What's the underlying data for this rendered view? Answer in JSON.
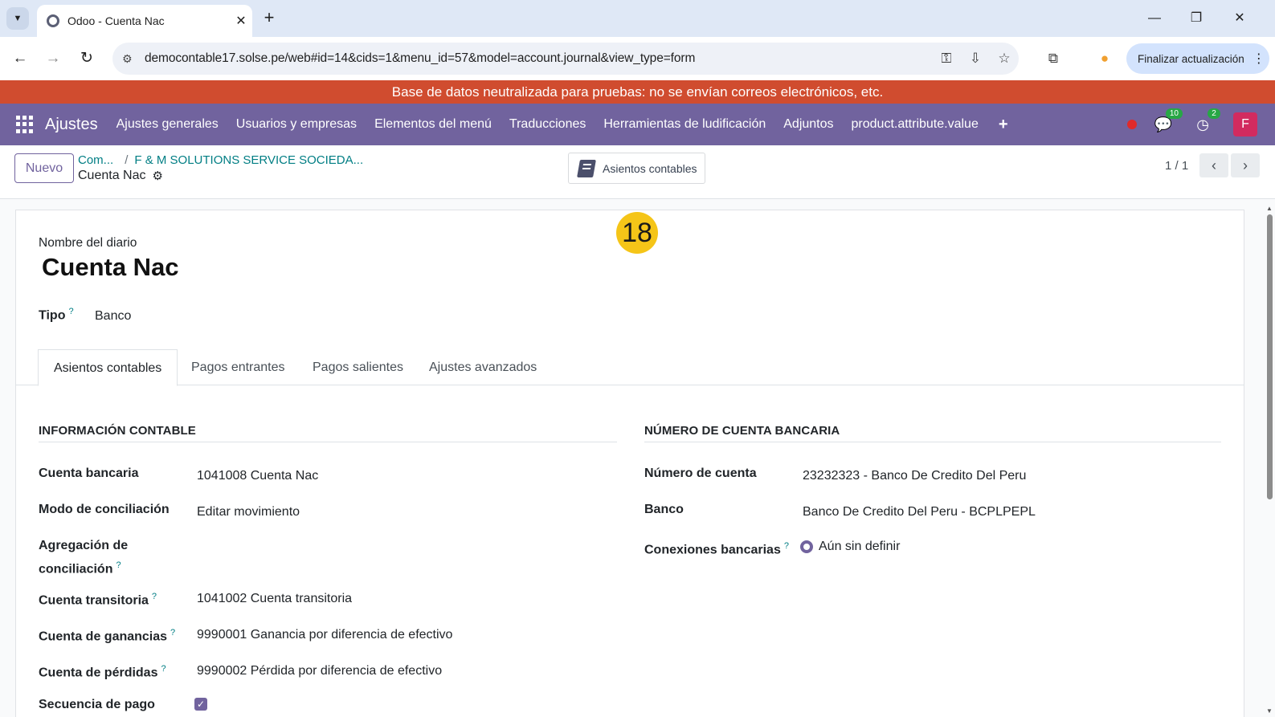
{
  "browser": {
    "tab_title": "Odoo - Cuenta Nac",
    "tab_close": "✕",
    "new_tab": "+",
    "url": "democontable17.solse.pe/web#id=14&cids=1&menu_id=57&model=account.journal&view_type=form",
    "update_button": "Finalizar actualización"
  },
  "banner": {
    "text": "Base de datos neutralizada para pruebas: no se envían correos electrónicos, etc."
  },
  "navbar": {
    "brand": "Ajustes",
    "items": [
      "Ajustes generales",
      "Usuarios y empresas",
      "Elementos del menú",
      "Traducciones",
      "Herramientas de ludificación",
      "Adjuntos",
      "product.attribute.value"
    ],
    "plus": "+",
    "messages_count": "10",
    "activities_count": "2",
    "avatar_letter": "F",
    "colors": {
      "navbar": "#71639e",
      "banner": "#d04c2f"
    }
  },
  "control_panel": {
    "new_button": "Nuevo",
    "breadcrumb_root": "Com...",
    "breadcrumb_sep": "/",
    "breadcrumb_company": "F & M SOLUTIONS SERVICE SOCIEDA...",
    "current": "Cuenta Nac",
    "smart_button": "Asientos contables",
    "pager": "1 / 1"
  },
  "step_badge": "18",
  "form": {
    "journal_name_label": "Nombre del diario",
    "journal_name": "Cuenta Nac",
    "type_label": "Tipo",
    "type_value": "Banco",
    "help_mark": "?",
    "tabs": [
      "Asientos contables",
      "Pagos entrantes",
      "Pagos salientes",
      "Ajustes avanzados"
    ],
    "left_section": {
      "title": "INFORMACIÓN CONTABLE",
      "fields": [
        {
          "label": "Cuenta bancaria",
          "value": "1041008 Cuenta Nac"
        },
        {
          "label": "Modo de conciliación",
          "value": "Editar movimiento"
        },
        {
          "label_line1": "Agregación de",
          "label_line2": "conciliación",
          "value": ""
        },
        {
          "label": "Cuenta transitoria",
          "value": "1041002 Cuenta transitoria"
        },
        {
          "label": "Cuenta de ganancias",
          "value": "9990001 Ganancia por diferencia de efectivo"
        },
        {
          "label": "Cuenta de pérdidas",
          "value": "9990002 Pérdida por diferencia de efectivo"
        },
        {
          "label": "Secuencia de pago",
          "value": ""
        }
      ]
    },
    "right_section": {
      "title": "NÚMERO DE CUENTA BANCARIA",
      "fields": [
        {
          "label": "Número de cuenta",
          "value": "23232323 - Banco De Credito Del Peru"
        },
        {
          "label": "Banco",
          "value": "Banco De Credito Del Peru - BCPLPEPL"
        },
        {
          "label": "Conexiones bancarias",
          "value": "Aún sin definir"
        }
      ]
    }
  }
}
